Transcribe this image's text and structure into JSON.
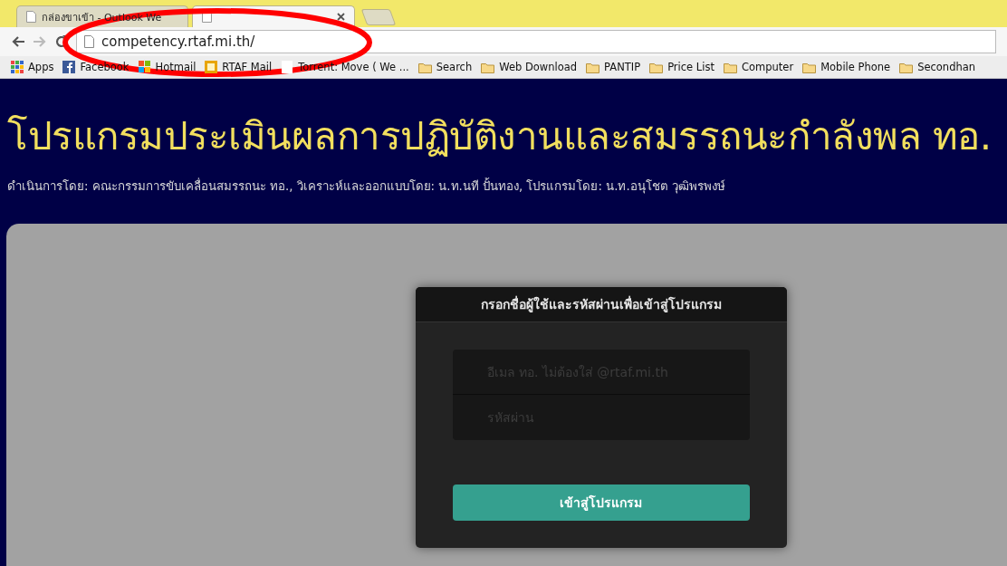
{
  "browser": {
    "tabs": [
      {
        "title": "กล่องขาเข้า - Outlook We",
        "selected": false
      },
      {
        "selected": true
      }
    ],
    "address": "competency.rtaf.mi.th/",
    "bookmarks": [
      {
        "label": "Apps",
        "kind": "apps"
      },
      {
        "label": "Facebook",
        "kind": "facebook"
      },
      {
        "label": "Hotmail",
        "kind": "windows"
      },
      {
        "label": "RTAF Mail",
        "kind": "mail"
      },
      {
        "label": "Torrent: Move ( We ...",
        "kind": "page"
      },
      {
        "label": "Search",
        "kind": "folder"
      },
      {
        "label": "Web Download",
        "kind": "folder"
      },
      {
        "label": "PANTIP",
        "kind": "folder"
      },
      {
        "label": "Price List",
        "kind": "folder"
      },
      {
        "label": "Computer",
        "kind": "folder"
      },
      {
        "label": "Mobile Phone",
        "kind": "folder"
      },
      {
        "label": "Secondhan",
        "kind": "folder"
      }
    ]
  },
  "header": {
    "title": "โปรแกรมประเมินผลการปฏิบัติงานและสมรรถนะกำลังพล ทอ.",
    "credits": "ดำเนินการโดย: คณะกรรมการขับเคลื่อนสมรรถนะ ทอ., วิเคราะห์และออกแบบโดย: น.ท.นที ปั้นทอง, โปรแกรมโดย: น.ท.อนุโชต วุฒิพรพงษ์"
  },
  "login": {
    "title": "กรอกชื่อผู้ใช้และรหัสผ่านเพื่อเข้าสู่โปรแกรม",
    "fields": [
      {
        "placeholder": "อีเมล ทอ. ไม่ต้องใส่ @rtaf.mi.th"
      },
      {
        "placeholder": "รหัสผ่าน"
      }
    ],
    "button": "เข้าสู่โปรแกรม"
  }
}
